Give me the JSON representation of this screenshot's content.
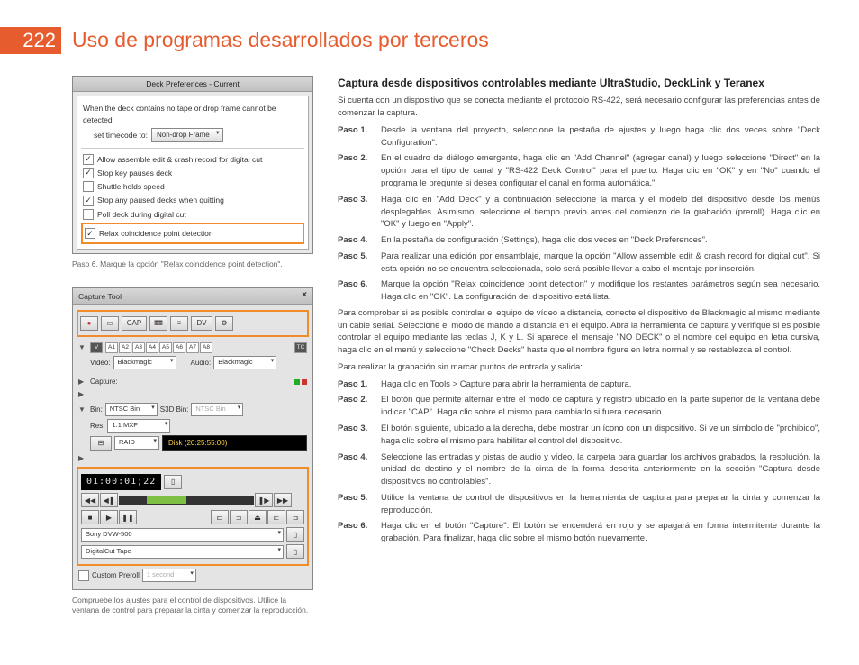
{
  "page_number": "222",
  "title": "Uso de programas desarrollados por terceros",
  "fig1": {
    "titlebar": "Deck Preferences - Current",
    "intro": "When the deck contains no tape or drop frame cannot be detected",
    "set_tc_label": "set timecode to:",
    "set_tc_value": "Non-drop Frame",
    "opt_assemble": "Allow assemble edit & crash record for digital cut",
    "opt_stopkey": "Stop key pauses deck",
    "opt_shuttle": "Shuttle holds speed",
    "opt_stopany": "Stop any paused decks when quitting",
    "opt_poll": "Poll deck during digital cut",
    "opt_relax": "Relax coincidence point detection",
    "caption": "Paso 6. Marque la opción \"Relax coincidence point detection\"."
  },
  "fig2": {
    "title": "Capture Tool",
    "cap_btn": "CAP",
    "dvlabel": "DV",
    "track_v": "V",
    "tracks": [
      "A1",
      "A2",
      "A3",
      "A4",
      "A5",
      "A6",
      "A7",
      "A8"
    ],
    "tc": "TC",
    "video_label": "Video:",
    "video_val": "Blackmagic",
    "audio_label": "Audio:",
    "audio_val": "Blackmagic",
    "capture_label": "Capture:",
    "bin_label": "Bin:",
    "bin_val": "NTSC Bin",
    "s3d_label": "S3D Bin:",
    "s3d_val": "NTSC Bin",
    "res_label": "Res:",
    "res_val": "1:1 MXF",
    "raid": "RAID",
    "disk": "Disk (20:25:55:00)",
    "timecode": "01:00:01;22",
    "deck_name": "Sony DVW-500",
    "tape_name": "DigitalCut Tape",
    "preroll_label": "Custom Preroll",
    "preroll_val": "1 second",
    "caption": "Compruebe los ajustes para el control de dispositivos.  Utilice la ventana de control para preparar la cinta y comenzar la reproducción."
  },
  "right": {
    "heading": "Captura desde dispositivos controlables mediante UltraStudio, DeckLink y Teranex",
    "intro": "Si cuenta con un dispositivo que se conecta mediante el protocolo RS-422, será necesario configurar las preferencias antes de comenzar la captura.",
    "stepsA": [
      {
        "n": "Paso 1.",
        "t": "Desde la ventana del proyecto, seleccione la pestaña de ajustes y luego haga clic dos veces sobre \"Deck Configuration\"."
      },
      {
        "n": "Paso 2.",
        "t": "En el cuadro de diálogo emergente, haga clic en \"Add Channel\" (agregar canal) y luego seleccione \"Direct\" en la opción para el tipo de canal y \"RS-422 Deck Control\" para el puerto.  Haga clic en \"OK\" y en \"No\" cuando el programa le pregunte si desea configurar el canal en forma automática.\""
      },
      {
        "n": "Paso 3.",
        "t": "Haga clic en \"Add Deck\" y a continuación seleccione la marca y el modelo del dispositivo desde los menús desplegables. Asimismo, seleccione el tiempo previo antes del comienzo de la grabación (preroll).   Haga clic en \"OK\" y luego en \"Apply\"."
      },
      {
        "n": "Paso 4.",
        "t": "En la pestaña de configuración (Settings), haga clic dos veces en \"Deck Preferences\"."
      },
      {
        "n": "Paso 5.",
        "t": "Para realizar una edición por ensamblaje, marque la opción \"Allow assemble edit & crash record for digital cut\". Si esta opción no se encuentra seleccionada, solo será posible llevar a cabo el montaje por inserción."
      },
      {
        "n": "Paso 6.",
        "t": "Marque la opción \"Relax coincidence point detection\" y modifique los restantes parámetros según sea necesario.  Haga clic en \"OK\". La configuración del dispositivo está lista."
      }
    ],
    "mid1": "Para comprobar si es posible controlar el equipo de vídeo a distancia, conecte el dispositivo de Blackmagic al mismo mediante un cable serial.    Seleccione el modo de mando a distancia en el equipo. Abra la herramienta de captura y verifique si es posible controlar el equipo mediante las teclas J, K y L. Si aparece el mensaje \"NO DECK\" o el nombre del equipo en letra cursiva, haga clic en el menú y seleccione \"Check Decks\" hasta que el nombre figure en letra normal y se restablezca el control.",
    "mid2": "Para realizar la grabación sin marcar puntos de entrada y salida:",
    "stepsB": [
      {
        "n": "Paso 1.",
        "t": "Haga clic en Tools > Capture para abrir la herramienta de captura."
      },
      {
        "n": "Paso 2.",
        "t": "El botón que permite alternar entre el modo de captura y registro ubicado en la parte superior de la ventana debe indicar \"CAP\". Haga clic sobre el mismo para cambiarlo si fuera necesario."
      },
      {
        "n": "Paso 3.",
        "t": "El botón siguiente, ubicado a la derecha, debe mostrar un ícono con un dispositivo. Si ve un símbolo de \"prohibido\", haga clic sobre el mismo para habilitar el control del dispositivo."
      },
      {
        "n": "Paso 4.",
        "t": "Seleccione las entradas y pistas de audio y vídeo, la carpeta para guardar los archivos grabados, la resolución, la unidad de destino y el nombre de la cinta de la forma descrita anteriormente en la sección \"Captura desde dispositivos no controlables\"."
      },
      {
        "n": "Paso 5.",
        "t": "Utilice la ventana de control de dispositivos en la herramienta de captura para preparar la cinta y comenzar la reproducción."
      },
      {
        "n": "Paso 6.",
        "t": "Haga clic en el botón \"Capture\". El botón se encenderá en rojo y se apagará en forma intermitente durante la grabación. Para finalizar, haga clic sobre el mismo botón nuevamente."
      }
    ]
  }
}
